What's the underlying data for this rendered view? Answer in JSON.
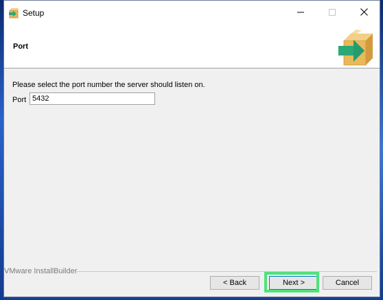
{
  "window": {
    "title": "Setup"
  },
  "header": {
    "title": "Port"
  },
  "content": {
    "instruction": "Please select the port number the server should listen on.",
    "port_label": "Port",
    "port_value": "5432"
  },
  "footer": {
    "brand": "VMware InstallBuilder",
    "back_label": "< Back",
    "next_label": "Next >",
    "cancel_label": "Cancel"
  },
  "colors": {
    "highlight": "#4ee37a",
    "box": "#e9b85a",
    "arrow": "#2aa876"
  },
  "icons": [
    "app-box-arrow-icon",
    "minimize-icon",
    "maximize-icon",
    "close-icon",
    "installer-logo-icon"
  ]
}
